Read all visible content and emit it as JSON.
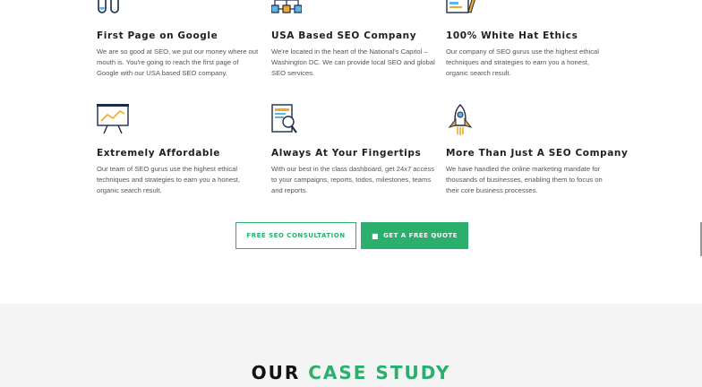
{
  "features": [
    {
      "title": "First Page on Google",
      "text": "We are so good at SEO, we put our money where out mouth is. You're going to reach the first page of Google with our USA based SEO company.",
      "icon": "test-tubes-icon"
    },
    {
      "title": "USA Based SEO Company",
      "text": "We're located in the heart of the National's Capitol – Washington DC. We can provide local SEO and global SEO services.",
      "icon": "network-flow-icon"
    },
    {
      "title": "100% White Hat Ethics",
      "text": "Our company of SEO gurus use the highest ethical techniques and strategies to earn you a honest, organic search result.",
      "icon": "window-pencil-icon"
    },
    {
      "title": "Extremely Affordable",
      "text": "Our team of SEO gurus use the highest ethical techniques and strategies to earn you a honest, organic search result.",
      "icon": "presentation-chart-icon"
    },
    {
      "title": "Always At Your Fingertips",
      "text": "With our best in the class dashboard, get 24x7 access to your campaigns, reports, todos, milestones, teams and reports.",
      "icon": "document-search-icon"
    },
    {
      "title": "More Than Just A SEO Company",
      "text": "We have handled the online marketing mandate for thousands of businesses, enabling them to focus on their core business processes.",
      "icon": "rocket-icon"
    }
  ],
  "buttons": {
    "consultation_label": "FREE SEO CONSULTATION",
    "quote_label": "GET A FREE QUOTE",
    "quote_icon": "chat-bubble-icon"
  },
  "case_study": {
    "word1": "OUR",
    "word2": "CASE STUDY"
  },
  "colors": {
    "accent": "#2aaf6c",
    "heading": "#1f1f1f",
    "body_text": "#555555",
    "orange": "#f5a623",
    "navy": "#1c2b4a",
    "blue": "#5fb3e6"
  }
}
